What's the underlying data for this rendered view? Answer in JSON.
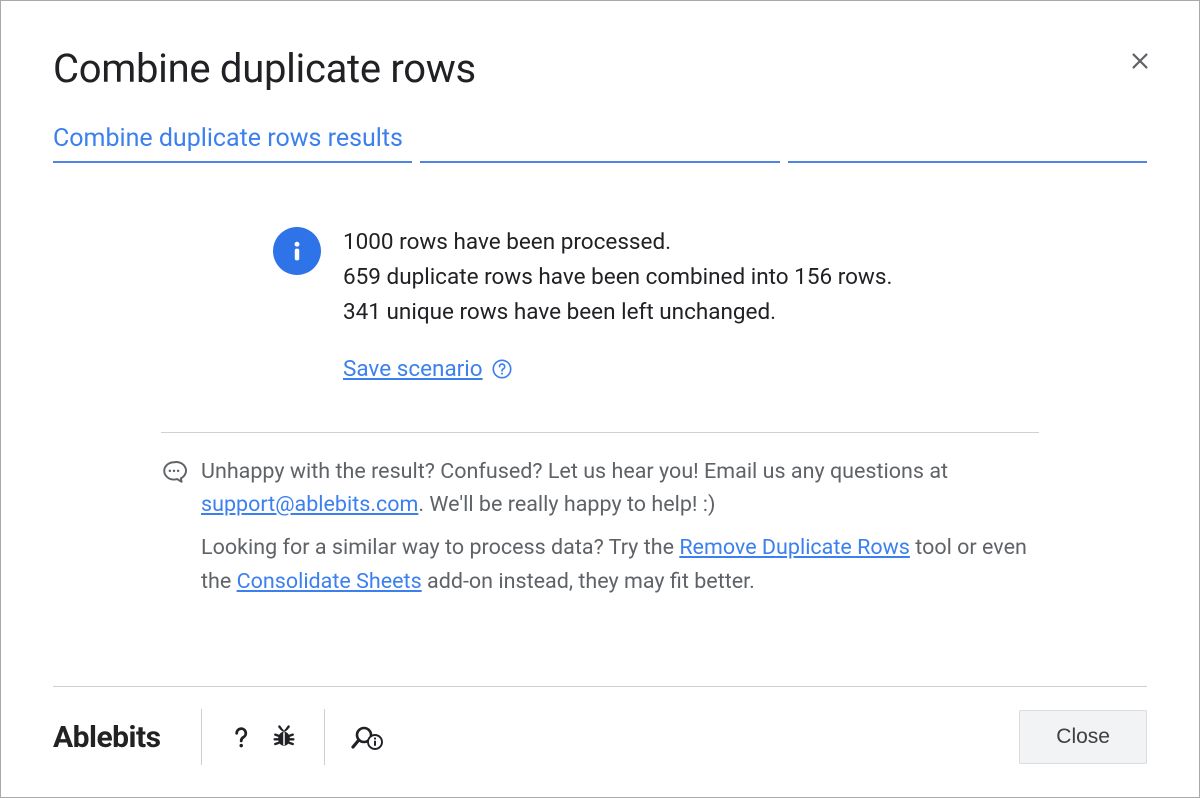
{
  "dialog": {
    "title": "Combine duplicate rows",
    "tab_label": "Combine duplicate rows results"
  },
  "results": {
    "line1": "1000 rows have been processed.",
    "line2": "659 duplicate rows have been combined into 156 rows.",
    "line3": "341 unique rows have been left unchanged.",
    "save_scenario": "Save scenario"
  },
  "support": {
    "feedback_pre": "Unhappy with the result? Confused? Let us hear you! Email us any questions at ",
    "email": "support@ablebits.com",
    "feedback_post": ". We'll be really happy to help! :)",
    "alt_pre": "Looking for a similar way to process data? Try the ",
    "alt_link1": "Remove Duplicate Rows",
    "alt_mid": " tool or even the ",
    "alt_link2": "Consolidate Sheets",
    "alt_post": " add-on instead, they may fit better."
  },
  "footer": {
    "brand": "Ablebits",
    "close": "Close"
  }
}
